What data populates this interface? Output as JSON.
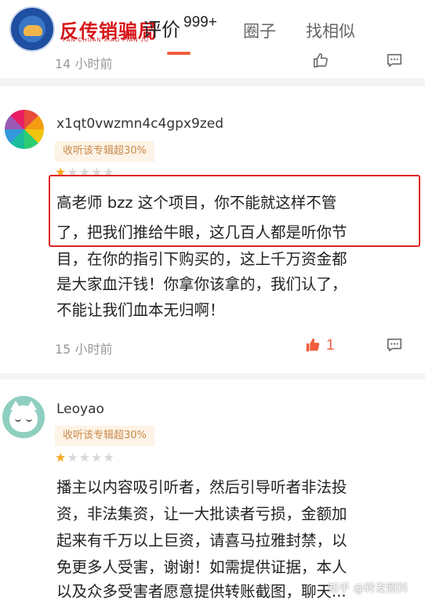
{
  "header": {
    "logo_text": "反传销骗局",
    "logo_subtext": "FAN CHUAN XIAO PIAN JU",
    "tabs": [
      {
        "label": "评价",
        "count": "999+",
        "active": true
      },
      {
        "label": "圈子",
        "active": false
      },
      {
        "label": "找相似",
        "active": false
      }
    ],
    "accent_color": "#f25c3c"
  },
  "prev_comment": {
    "time": "14 小时前"
  },
  "comments": [
    {
      "username": "x1qt0vwzmn4c4gpx9zed",
      "badge": "收听该专辑超30%",
      "rating": 1,
      "lines": [
        "高老师 bzz 这个项目，你不能就这样不管",
        "了，把我们推给牛眼，这几百人都是听你节",
        "目，在你的指引下购买的，这上千万资金都",
        "是大家血汗钱！你拿你该拿的，我们认了，",
        "不能让我们血本无归啊！"
      ],
      "time": "15 小时前",
      "likes": "1"
    },
    {
      "username": "Leoyao",
      "badge": "收听该专辑超30%",
      "rating": 1,
      "lines": [
        "播主以内容吸引听者，然后引导听者非法投",
        "资，非法集资，让一大批读者亏损，金额加",
        "起来有千万以上巨资，请喜马拉雅封禁，以",
        "免更多人受害，谢谢！如需提供证据，本人",
        "以及众多受害者愿意提供转账截图，聊天..."
      ]
    }
  ],
  "watermark": "知乎 @转发照料"
}
